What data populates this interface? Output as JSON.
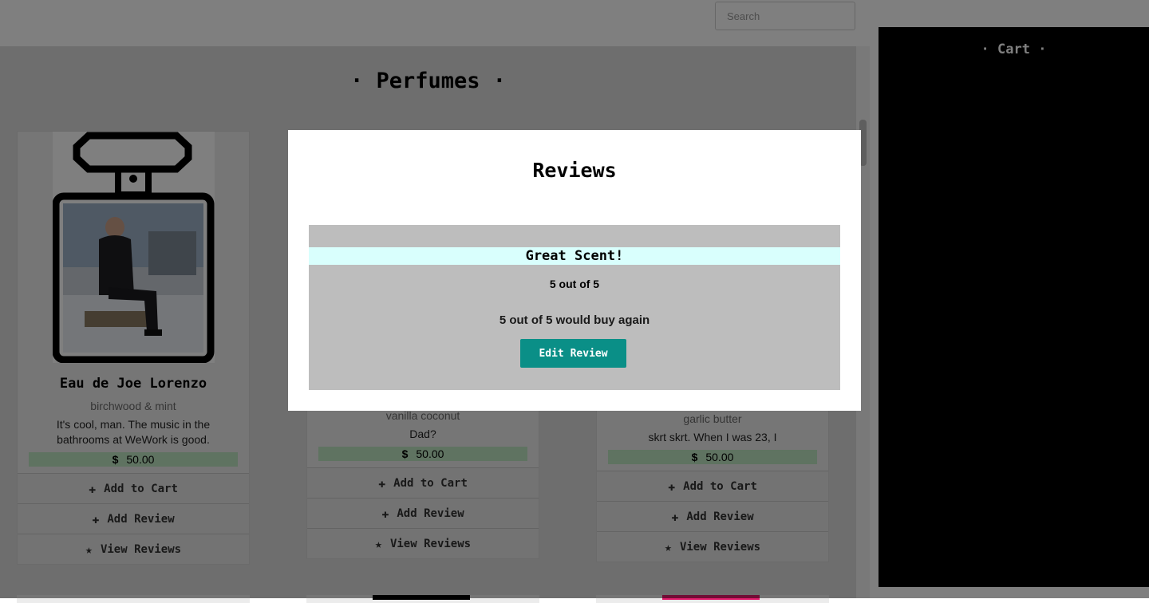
{
  "search": {
    "placeholder": "Search"
  },
  "section": {
    "title": "· Perfumes ·"
  },
  "cards": [
    {
      "name": "Eau de Joe Lorenzo",
      "notes": "birchwood & mint",
      "description": "It's cool, man. The music in the bathrooms at WeWork is good.",
      "currency": "$",
      "price": "50.00",
      "add_to_cart": "Add to Cart",
      "add_review": "Add Review",
      "view_reviews": "View Reviews"
    },
    {
      "name": "",
      "notes": "vanilla coconut",
      "description": "Dad?",
      "currency": "$",
      "price": "50.00",
      "add_to_cart": "Add to Cart",
      "add_review": "Add Review",
      "view_reviews": "View Reviews"
    },
    {
      "name": "",
      "notes": "garlic butter",
      "description": "skrt skrt. When I was 23, I",
      "currency": "$",
      "price": "50.00",
      "add_to_cart": "Add to Cart",
      "add_review": "Add Review",
      "view_reviews": "View Reviews"
    }
  ],
  "cart": {
    "title": "· Cart ·"
  },
  "modal": {
    "title": "Reviews",
    "review": {
      "title": "Great Scent!",
      "rating": "5 out of 5",
      "body": "5 out of 5 would buy again",
      "edit_label": "Edit Review"
    }
  },
  "icons": {
    "plus": "plus-icon",
    "star": "star-icon"
  },
  "colors": {
    "accent": "#0a8f87",
    "price_bg": "#bfe6c3",
    "review_title_bg": "#d9fffd",
    "cart_bg": "#000000"
  }
}
